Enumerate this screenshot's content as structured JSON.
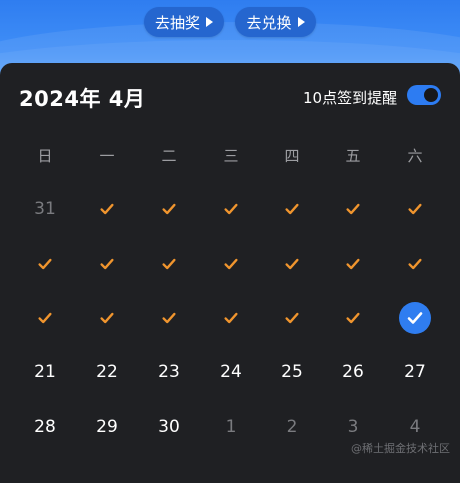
{
  "header": {
    "lottery_label": "去抽奖",
    "exchange_label": "去兑换"
  },
  "calendar": {
    "title": "2024年 4月",
    "reminder_label": "10点签到提醒",
    "reminder_on": true,
    "accent_color": "#2f7df0",
    "check_color": "#f0952e",
    "weekdays": [
      "日",
      "一",
      "二",
      "三",
      "四",
      "五",
      "六"
    ],
    "rows": [
      [
        {
          "text": "31",
          "dim": true
        },
        {
          "check": true
        },
        {
          "check": true
        },
        {
          "check": true
        },
        {
          "check": true
        },
        {
          "check": true
        },
        {
          "check": true
        }
      ],
      [
        {
          "check": true
        },
        {
          "check": true
        },
        {
          "check": true
        },
        {
          "check": true
        },
        {
          "check": true
        },
        {
          "check": true
        },
        {
          "check": true
        }
      ],
      [
        {
          "check": true
        },
        {
          "check": true
        },
        {
          "check": true
        },
        {
          "check": true
        },
        {
          "check": true
        },
        {
          "check": true
        },
        {
          "selected": true
        }
      ],
      [
        {
          "text": "21"
        },
        {
          "text": "22"
        },
        {
          "text": "23"
        },
        {
          "text": "24"
        },
        {
          "text": "25"
        },
        {
          "text": "26"
        },
        {
          "text": "27"
        }
      ],
      [
        {
          "text": "28"
        },
        {
          "text": "29"
        },
        {
          "text": "30"
        },
        {
          "text": "1",
          "dim": true
        },
        {
          "text": "2",
          "dim": true
        },
        {
          "text": "3",
          "dim": true
        },
        {
          "text": "4",
          "dim": true
        }
      ]
    ]
  },
  "watermark": "@稀土掘金技术社区"
}
